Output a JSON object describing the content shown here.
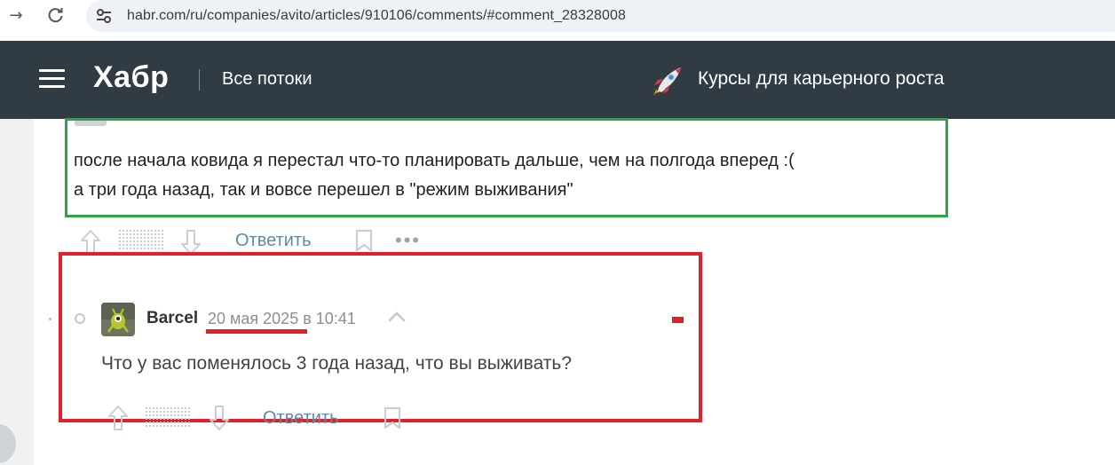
{
  "browser": {
    "back_icon": "arrow-right-icon",
    "reload_icon": "reload-icon",
    "site_info_icon": "tune-icon",
    "url": "habr.com/ru/companies/avito/articles/910106/comments/#comment_28328008"
  },
  "header": {
    "menu_icon": "hamburger-icon",
    "logo": "Хабр",
    "flows_label": "Все потоки",
    "courses_label": "Курсы для карьерного роста",
    "courses_icon": "rocket-icon",
    "background_color": "#303b44"
  },
  "comment_parent": {
    "lines": [
      "после начала ковида я перестал что-то планировать дальше, чем на полгода вперед :(",
      "а три года назад, так и вовсе перешел в \"режим выживания\""
    ],
    "reply_label": "Ответить",
    "highlight_color": "#27a844"
  },
  "comment_reply": {
    "author": "Barcel",
    "date": "20 мая 2025",
    "time_prefix": "в",
    "time": "10:41",
    "text": "Что у вас поменялось 3 года назад, что вы выживать?",
    "reply_label": "Ответить",
    "highlight_color": "#e0202a"
  }
}
